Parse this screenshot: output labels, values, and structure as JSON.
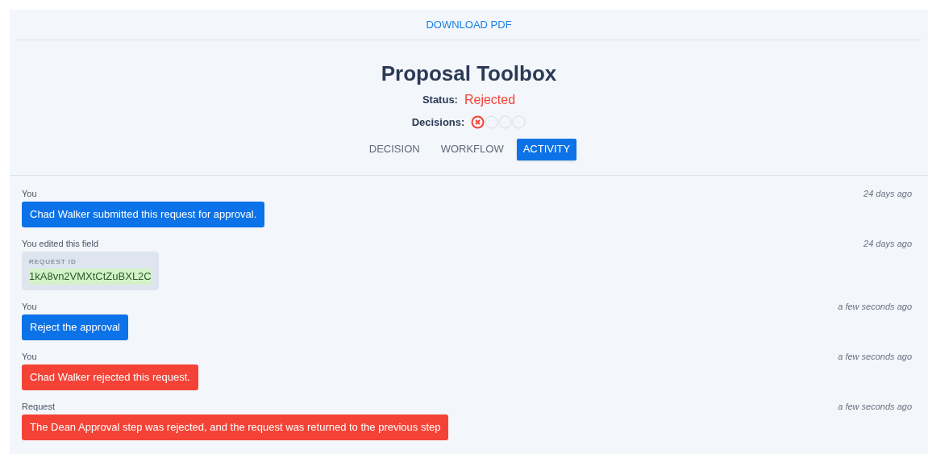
{
  "download_link": "DOWNLOAD PDF",
  "title": "Proposal Toolbox",
  "status": {
    "label": "Status:",
    "value": "Rejected"
  },
  "decisions": {
    "label": "Decisions:",
    "items": [
      {
        "kind": "rejected"
      },
      {
        "kind": "pending"
      },
      {
        "kind": "pending"
      },
      {
        "kind": "pending"
      }
    ]
  },
  "tabs": [
    {
      "label": "DECISION",
      "selected": false
    },
    {
      "label": "WORKFLOW",
      "selected": false
    },
    {
      "label": "ACTIVITY",
      "selected": true
    }
  ],
  "activity": [
    {
      "kind": "message",
      "author": "You",
      "time": "24 days ago",
      "text": "Chad Walker submitted this request for approval.",
      "color": "#0b72e7"
    },
    {
      "kind": "field_edit",
      "author": "You edited this field",
      "time": "24 days ago",
      "field": "REQUEST ID",
      "value": "1kA8vn2VMXtCtZuBXL2C"
    },
    {
      "kind": "message",
      "author": "You",
      "time": "a few seconds ago",
      "text": "Reject the approval",
      "color": "#0b72e7"
    },
    {
      "kind": "message",
      "author": "You",
      "time": "a few seconds ago",
      "text": "Chad Walker rejected this request.",
      "color": "#f44336"
    },
    {
      "kind": "message",
      "author": "Request",
      "time": "a few seconds ago",
      "text": "The Dean Approval step was rejected, and the request was returned to the previous step",
      "color": "#f44336"
    }
  ]
}
